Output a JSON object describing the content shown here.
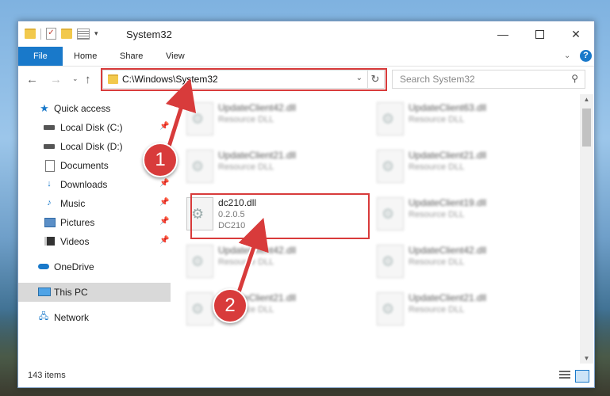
{
  "window": {
    "title": "System32"
  },
  "ribbon": {
    "tabs": [
      "File",
      "Home",
      "Share",
      "View"
    ],
    "help": "?"
  },
  "address": {
    "path": "C:\\Windows\\System32"
  },
  "search": {
    "placeholder": "Search System32"
  },
  "sidebar": {
    "items": [
      {
        "label": "Quick access",
        "icon": "star-icon",
        "pinned": false
      },
      {
        "label": "Local Disk (C:)",
        "icon": "disk-icon",
        "pinned": true
      },
      {
        "label": "Local Disk (D:)",
        "icon": "disk-icon",
        "pinned": false
      },
      {
        "label": "Documents",
        "icon": "documents-icon",
        "pinned": true
      },
      {
        "label": "Downloads",
        "icon": "downloads-icon",
        "pinned": true
      },
      {
        "label": "Music",
        "icon": "music-icon",
        "pinned": true
      },
      {
        "label": "Pictures",
        "icon": "pictures-icon",
        "pinned": true
      },
      {
        "label": "Videos",
        "icon": "videos-icon",
        "pinned": true
      },
      {
        "label": "OneDrive",
        "icon": "onedrive-icon",
        "pinned": false
      },
      {
        "label": "This PC",
        "icon": "this-pc-icon",
        "pinned": false,
        "selected": true
      },
      {
        "label": "Network",
        "icon": "network-icon",
        "pinned": false
      }
    ]
  },
  "files": [
    {
      "name": "UpdateClient42.dll",
      "desc": "Resource DLL",
      "blurred": true
    },
    {
      "name": "UpdateClient63.dll",
      "desc": "Resource DLL",
      "blurred": true
    },
    {
      "name": "UpdateClient21.dll",
      "desc": "Resource DLL",
      "blurred": true
    },
    {
      "name": "UpdateClient21.dll",
      "desc": "Resource DLL",
      "blurred": true
    },
    {
      "name": "dc210.dll",
      "desc": "0.2.0.5",
      "desc2": "DC210",
      "blurred": false
    },
    {
      "name": "UpdateClient19.dll",
      "desc": "Resource DLL",
      "blurred": true
    },
    {
      "name": "UpdateClient42.dll",
      "desc": "Resource DLL",
      "blurred": true
    },
    {
      "name": "UpdateClient42.dll",
      "desc": "Resource DLL",
      "blurred": true
    },
    {
      "name": "UpdateClient21.dll",
      "desc": "Resource DLL",
      "blurred": true
    },
    {
      "name": "UpdateClient21.dll",
      "desc": "Resource DLL",
      "blurred": true
    }
  ],
  "status": {
    "count": "143 items"
  },
  "callouts": {
    "one": "1",
    "two": "2"
  },
  "colors": {
    "accent": "#1979ca",
    "highlight": "#d83b3b"
  }
}
